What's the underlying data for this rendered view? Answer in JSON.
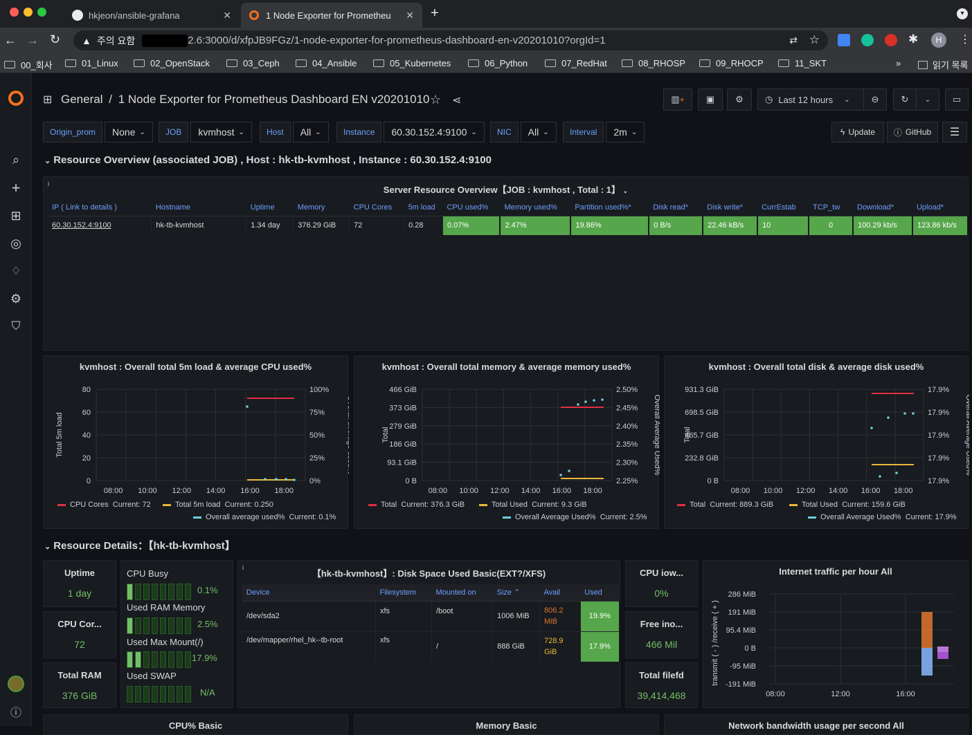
{
  "browser": {
    "tabs": [
      {
        "title": "hkjeon/ansible-grafana",
        "icon": "github-icon"
      },
      {
        "title": "1 Node Exporter for Prometheu",
        "icon": "grafana-icon"
      }
    ],
    "security_label": "주의 요함",
    "url": "2.6:3000/d/xfpJB9FGz/1-node-exporter-for-prometheus-dashboard-en-v20201010?orgId=1",
    "profile_initial": "H",
    "bookmarks": [
      "00_회사",
      "01_Linux",
      "02_OpenStack",
      "03_Ceph",
      "04_Ansible",
      "05_Kubernetes",
      "06_Python",
      "07_RedHat",
      "08_RHOSP",
      "09_RHOCP",
      "11_SKT"
    ],
    "bookmarks_more": "»",
    "reading_list": "읽기 목록"
  },
  "header": {
    "folder": "General",
    "separator": "/",
    "title": "1 Node Exporter for Prometheus Dashboard EN v20201010",
    "time_range": "Last 12 hours"
  },
  "variables": [
    {
      "label": "Origin_prom",
      "value": "None"
    },
    {
      "label": "JOB",
      "value": "kvmhost"
    },
    {
      "label": "Host",
      "value": "All"
    },
    {
      "label": "Instance",
      "value": "60.30.152.4:9100"
    },
    {
      "label": "NIC",
      "value": "All"
    },
    {
      "label": "Interval",
      "value": "2m"
    }
  ],
  "links": {
    "update": "Update",
    "github": "GitHub"
  },
  "row1": {
    "title": "Resource Overview (associated JOB) , Host : hk-tb-kvmhost , Instance : 60.30.152.4:9100"
  },
  "overview_table": {
    "title": "Server Resource Overview【JOB : kvmhost , Total : 1】",
    "columns": [
      "IP ( Link to details )",
      "Hostname",
      "Uptime",
      "Memory",
      "CPU Cores",
      "5m load",
      "CPU used%",
      "Memory used%",
      "Partition used%*",
      "Disk read*",
      "Disk write*",
      "CurrEstab",
      "TCP_tw",
      "Download*",
      "Upload*"
    ],
    "rows": [
      [
        "60.30.152.4:9100",
        "hk-tb-kvmhost",
        "1.34 day",
        "376.29 GiB",
        "72",
        "0.28",
        "0.07%",
        "2.47%",
        "19.86%",
        "0 B/s",
        "22.46 kB/s",
        "10",
        "0",
        "100.29 kb/s",
        "123.86 kb/s"
      ]
    ]
  },
  "charts_row": {
    "cpu": {
      "title": "kvmhost : Overall total 5m load & average CPU used%",
      "y_left": [
        "80",
        "60",
        "40",
        "20",
        "0"
      ],
      "y_right": [
        "100%",
        "75%",
        "50%",
        "25%",
        "0%"
      ],
      "ylabel_left": "Total 5m load",
      "ylabel_right": "Overall average used%",
      "x": [
        "08:00",
        "10:00",
        "12:00",
        "14:00",
        "16:00",
        "18:00"
      ],
      "legend": [
        {
          "name": "CPU Cores",
          "current": "Current: 72",
          "color": "#e02f44"
        },
        {
          "name": "Total 5m load",
          "current": "Current: 0.250",
          "color": "#eab839"
        },
        {
          "name": "Overall average used%",
          "current": "Current: 0.1%",
          "color": "#6ed0e0"
        }
      ]
    },
    "memory": {
      "title": "kvmhost : Overall total memory & average memory used%",
      "y_left": [
        "466 GiB",
        "373 GiB",
        "279 GiB",
        "186 GiB",
        "93.1 GiB",
        "0 B"
      ],
      "y_right": [
        "2.50%",
        "2.45%",
        "2.40%",
        "2.35%",
        "2.30%",
        "2.25%"
      ],
      "ylabel_left": "Total",
      "ylabel_right": "Overall Average Used%",
      "x": [
        "08:00",
        "10:00",
        "12:00",
        "14:00",
        "16:00",
        "18:00"
      ],
      "legend": [
        {
          "name": "Total",
          "current": "Current: 376.3 GiB",
          "color": "#e02f44"
        },
        {
          "name": "Total Used",
          "current": "Current: 9.3 GiB",
          "color": "#eab839"
        },
        {
          "name": "Overall Average Used%",
          "current": "Current: 2.5%",
          "color": "#6ed0e0"
        }
      ]
    },
    "disk": {
      "title": "kvmhost : Overall total disk & average disk used%",
      "y_left": [
        "931.3 GiB",
        "698.5 GiB",
        "465.7 GiB",
        "232.8 GiB",
        "0 B"
      ],
      "y_right": [
        "17.9%",
        "17.9%",
        "17.9%",
        "17.9%",
        "17.9%"
      ],
      "ylabel_left": "Total",
      "ylabel_right": "Overall Average Used%",
      "x": [
        "08:00",
        "10:00",
        "12:00",
        "14:00",
        "16:00",
        "18:00"
      ],
      "legend": [
        {
          "name": "Total",
          "current": "Current: 889.3 GiB",
          "color": "#e02f44"
        },
        {
          "name": "Total Used",
          "current": "Current: 159.6 GiB",
          "color": "#eab839"
        },
        {
          "name": "Overall Average Used%",
          "current": "Current: 17.9%",
          "color": "#6ed0e0"
        }
      ]
    }
  },
  "row2": {
    "title": "Resource Details：【hk-tb-kvmhost】"
  },
  "stats_left": [
    {
      "title": "Uptime",
      "value": "1 day"
    },
    {
      "title": "CPU Cor...",
      "value": "72"
    },
    {
      "title": "Total RAM",
      "value": "376 GiB"
    }
  ],
  "bar_gauges": [
    {
      "label": "CPU Busy",
      "value": "0.1%",
      "level": 0.001
    },
    {
      "label": "Used RAM Memory",
      "value": "2.5%",
      "level": 0.025
    },
    {
      "label": "Used Max Mount(/)",
      "value": "17.9%",
      "level": 0.179
    },
    {
      "label": "Used SWAP",
      "value": "N/A",
      "level": 0
    }
  ],
  "disk_table": {
    "title": "【hk-tb-kvmhost】: Disk Space Used Basic(EXT?/XFS)",
    "columns": [
      "Device",
      "Filesystem",
      "Mounted on",
      "Size",
      "Avail",
      "Used"
    ],
    "rows": [
      [
        "/dev/sda2",
        "xfs",
        "/boot",
        "1006 MiB",
        "806.2 MiB",
        "19.9%"
      ],
      [
        "/dev/mapper/rhel_hk--tb-root",
        "xfs",
        "/",
        "888 GiB",
        "728.9 GiB",
        "17.9%"
      ]
    ]
  },
  "stats_right": [
    {
      "title": "CPU iow...",
      "value": "0%"
    },
    {
      "title": "Free ino...",
      "value": "466 Mil"
    },
    {
      "title": "Total filefd",
      "value": "39,414,468"
    }
  ],
  "traffic": {
    "title": "Internet traffic per hour All",
    "y": [
      "286 MiB",
      "191 MiB",
      "95.4 MiB",
      "0 B",
      "-95 MiB",
      "-191 MiB"
    ],
    "ylabel": "transmit ( - ) /receive ( + )",
    "x": [
      "08:00",
      "12:00",
      "16:00"
    ]
  },
  "bottom_titles": [
    "CPU% Basic",
    "Memory Basic",
    "Network bandwidth usage per second All"
  ],
  "colors": {
    "accent": "#6e9fff",
    "green": "#56a64b",
    "red": "#e02f44",
    "yellow": "#eab839",
    "cyan": "#6ed0e0",
    "orange": "#e0b400"
  }
}
